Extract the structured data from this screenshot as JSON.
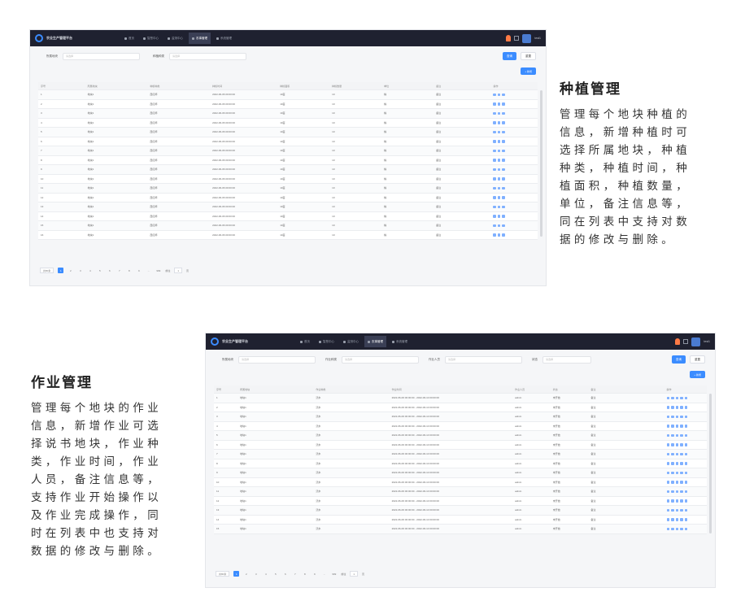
{
  "section_planting": {
    "title": "种植管理",
    "lines": [
      "管理每个地块种植的",
      "信息，新增种植时可",
      "选择所属地块，种植",
      "种类，种植时间，种",
      "植面积，种植数量，",
      "单位，备注信息等，",
      "同在列表中支持对数",
      "据的修改与删除。"
    ]
  },
  "section_work": {
    "title": "作业管理",
    "lines": [
      "管理每个地块的作业",
      "信息，新增作业可选",
      "择说书地块，作业种",
      "类，作业时间，作业",
      "人员，备注信息等，",
      "支持作业开始操作以",
      "及作业完成操作，同",
      "时在列表中也支持对",
      "数据的修改与删除。"
    ]
  },
  "app": {
    "title": "农业生产管理平台",
    "nav": [
      "首页",
      "智慧中心",
      "监测中心",
      "农事管理",
      "系统管理"
    ],
    "user": "test1",
    "query_label": "查询",
    "reset_label": "重置",
    "add_label": "+ 新增"
  },
  "screen_planting": {
    "filters": [
      {
        "label": "所属地块",
        "placeholder": "请选择"
      },
      {
        "label": "种植种类",
        "placeholder": "请选择"
      }
    ],
    "columns": [
      "序号",
      "所属地块",
      "种植种类",
      "种植时间",
      "种植面积",
      "种植数量",
      "单位",
      "备注",
      "操作"
    ],
    "rows": [
      [
        "1",
        "地块1",
        "西红柿",
        "2022-06-06 00:00:00",
        "10亩",
        "10",
        "株",
        "备注"
      ],
      [
        "2",
        "地块1",
        "西红柿",
        "2022-06-06 00:00:00",
        "10亩",
        "10",
        "株",
        "备注"
      ],
      [
        "3",
        "地块1",
        "西红柿",
        "2022-06-06 00:00:00",
        "10亩",
        "10",
        "株",
        "备注"
      ],
      [
        "4",
        "地块1",
        "西红柿",
        "2022-06-06 00:00:00",
        "10亩",
        "10",
        "株",
        "备注"
      ],
      [
        "5",
        "地块1",
        "西红柿",
        "2022-06-06 00:00:00",
        "10亩",
        "10",
        "株",
        "备注"
      ],
      [
        "6",
        "地块1",
        "西红柿",
        "2022-06-06 00:00:00",
        "10亩",
        "10",
        "株",
        "备注"
      ],
      [
        "7",
        "地块1",
        "西红柿",
        "2022-06-06 00:00:00",
        "10亩",
        "10",
        "株",
        "备注"
      ],
      [
        "8",
        "地块1",
        "西红柿",
        "2022-06-06 00:00:00",
        "10亩",
        "10",
        "株",
        "备注"
      ],
      [
        "9",
        "地块1",
        "西红柿",
        "2022-06-06 00:00:00",
        "10亩",
        "10",
        "株",
        "备注"
      ],
      [
        "10",
        "地块1",
        "西红柿",
        "2022-06-06 00:00:00",
        "10亩",
        "10",
        "株",
        "备注"
      ],
      [
        "11",
        "地块1",
        "西红柿",
        "2022-06-06 00:00:00",
        "10亩",
        "10",
        "株",
        "备注"
      ],
      [
        "12",
        "地块1",
        "西红柿",
        "2022-06-06 00:00:00",
        "10亩",
        "10",
        "株",
        "备注"
      ],
      [
        "13",
        "地块1",
        "西红柿",
        "2022-06-06 00:00:00",
        "10亩",
        "10",
        "株",
        "备注"
      ],
      [
        "14",
        "地块1",
        "西红柿",
        "2022-06-06 00:00:00",
        "10亩",
        "10",
        "株",
        "备注"
      ],
      [
        "15",
        "地块1",
        "西红柿",
        "2022-06-06 00:00:00",
        "10亩",
        "10",
        "株",
        "备注"
      ],
      [
        "16",
        "地块1",
        "西红柿",
        "2022-06-06 00:00:00",
        "10亩",
        "10",
        "株",
        "备注"
      ]
    ],
    "pager": {
      "total": "共80条",
      "pages": [
        "1",
        "2",
        "3",
        "4",
        "5",
        "6",
        "7",
        "8",
        "9",
        "...",
        "999"
      ],
      "goto": "前往",
      "page_value": "1",
      "page_unit": "页"
    }
  },
  "screen_work": {
    "filters": [
      {
        "label": "所属地块",
        "placeholder": "请选择"
      },
      {
        "label": "作业种类",
        "placeholder": "请选择"
      },
      {
        "label": "作业人员",
        "placeholder": "请选择"
      },
      {
        "label": "状态",
        "placeholder": "请选择"
      }
    ],
    "columns": [
      "序号",
      "所属地块",
      "作业种类",
      "作业时间",
      "作业人员",
      "状态",
      "备注",
      "操作"
    ],
    "rows": [
      [
        "1",
        "地块1",
        "浇水",
        "2022-06-06 00:00:00 - 2022-06-10 00:00:00",
        "admin",
        "未开始",
        "备注"
      ],
      [
        "2",
        "地块1",
        "浇水",
        "2022-06-06 00:00:00 - 2022-06-10 00:00:00",
        "admin",
        "未开始",
        "备注"
      ],
      [
        "3",
        "地块1",
        "浇水",
        "2022-06-06 00:00:00 - 2022-06-10 00:00:00",
        "admin",
        "未开始",
        "备注"
      ],
      [
        "4",
        "地块1",
        "浇水",
        "2022-06-06 00:00:00 - 2022-06-10 00:00:00",
        "admin",
        "未开始",
        "备注"
      ],
      [
        "5",
        "地块1",
        "浇水",
        "2022-06-06 00:00:00 - 2022-06-10 00:00:00",
        "admin",
        "未开始",
        "备注"
      ],
      [
        "6",
        "地块1",
        "浇水",
        "2022-06-06 00:00:00 - 2022-06-10 00:00:00",
        "admin",
        "未开始",
        "备注"
      ],
      [
        "7",
        "地块1",
        "浇水",
        "2022-06-06 00:00:00 - 2022-06-10 00:00:00",
        "admin",
        "未开始",
        "备注"
      ],
      [
        "8",
        "地块1",
        "浇水",
        "2022-06-06 00:00:00 - 2022-06-10 00:00:00",
        "admin",
        "未开始",
        "备注"
      ],
      [
        "9",
        "地块1",
        "浇水",
        "2022-06-06 00:00:00 - 2022-06-10 00:00:00",
        "admin",
        "未开始",
        "备注"
      ],
      [
        "10",
        "地块1",
        "浇水",
        "2022-06-06 00:00:00 - 2022-06-10 00:00:00",
        "admin",
        "未开始",
        "备注"
      ],
      [
        "11",
        "地块1",
        "浇水",
        "2022-06-06 00:00:00 - 2022-06-10 00:00:00",
        "admin",
        "未开始",
        "备注"
      ],
      [
        "12",
        "地块1",
        "浇水",
        "2022-06-06 00:00:00 - 2022-06-10 00:00:00",
        "admin",
        "未开始",
        "备注"
      ],
      [
        "13",
        "地块1",
        "浇水",
        "2022-06-06 00:00:00 - 2022-06-10 00:00:00",
        "admin",
        "未开始",
        "备注"
      ],
      [
        "14",
        "地块1",
        "浇水",
        "2022-06-06 00:00:00 - 2022-06-10 00:00:00",
        "admin",
        "未开始",
        "备注"
      ],
      [
        "15",
        "地块1",
        "浇水",
        "2022-06-06 00:00:00 - 2022-06-10 00:00:00",
        "admin",
        "未开始",
        "备注"
      ]
    ],
    "pager": {
      "total": "共80条",
      "pages": [
        "1",
        "2",
        "3",
        "4",
        "5",
        "6",
        "7",
        "8",
        "9",
        "...",
        "999"
      ],
      "goto": "前往",
      "page_value": "1",
      "page_unit": "页"
    }
  },
  "colors": {
    "topbar": "#1f2130",
    "accent": "#3b8cff",
    "background": "#f5f6f8"
  }
}
